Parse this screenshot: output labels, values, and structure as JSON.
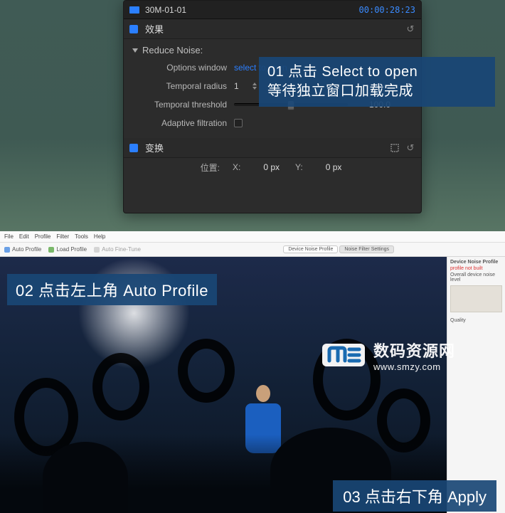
{
  "clip": {
    "title": "30M-01-01",
    "timecode": "00:00:28:23"
  },
  "sections": {
    "effects_label": "效果",
    "transform_label": "变换"
  },
  "reduce_noise": {
    "title": "Reduce Noise:",
    "options_window_label": "Options window",
    "options_window_value": "select to open",
    "temporal_radius_label": "Temporal radius",
    "temporal_radius_value": "1",
    "temporal_threshold_label": "Temporal threshold",
    "temporal_threshold_value": "100.0",
    "adaptive_filtration_label": "Adaptive filtration"
  },
  "transform": {
    "position_label": "位置:",
    "x_label": "X:",
    "x_value": "0 px",
    "y_label": "Y:",
    "y_value": "0 px"
  },
  "callouts": {
    "c1_line1": "01 点击 Select to open",
    "c1_line2": "等待独立窗口加载完成",
    "c2": "02 点击左上角 Auto Profile",
    "c3": "03 点击右下角 Apply"
  },
  "app2": {
    "menu": [
      "File",
      "Edit",
      "Profile",
      "Filter",
      "Tools",
      "Help"
    ],
    "toolbar": {
      "auto_profile": "Auto Profile",
      "load_profile": "Load Profile",
      "fine_tune": "Auto Fine-Tune"
    },
    "tabs": {
      "active": "Device Noise Profile",
      "other": "Noise Filter Settings"
    },
    "side": {
      "header": "Device Noise Profile",
      "red_line": "profile not built",
      "note": "Overall device noise level",
      "quality": "Quality"
    }
  },
  "watermark": {
    "line1": "数码资源网",
    "line2": "www.smzy.com"
  }
}
